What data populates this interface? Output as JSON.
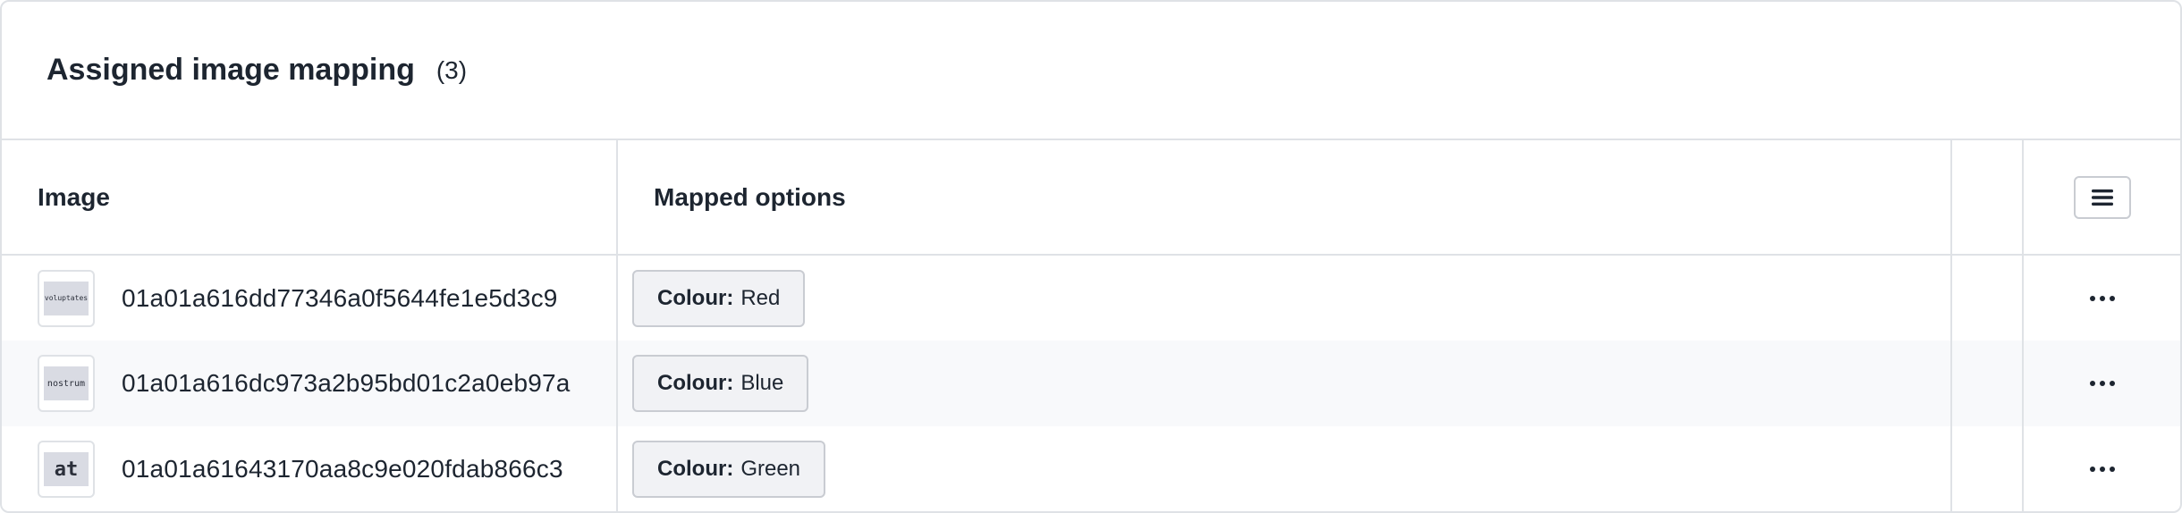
{
  "header": {
    "title": "Assigned image mapping",
    "count": "(3)"
  },
  "table": {
    "columns": {
      "image": "Image",
      "mapped_options": "Mapped options"
    },
    "rows": [
      {
        "thumb_text": "voluptates",
        "hash": "01a01a616dd77346a0f5644fe1e5d3c9",
        "option_key": "Colour:",
        "option_value": "Red"
      },
      {
        "thumb_text": "nostrum",
        "hash": "01a01a616dc973a2b95bd01c2a0eb97a",
        "option_key": "Colour:",
        "option_value": "Blue"
      },
      {
        "thumb_text": "at",
        "hash": "01a01a61643170aa8c9e020fdab866c3",
        "option_key": "Colour:",
        "option_value": "Green"
      }
    ]
  },
  "icons": {
    "column_menu": "hamburger-menu-icon",
    "row_actions": "more-horizontal-icon"
  }
}
